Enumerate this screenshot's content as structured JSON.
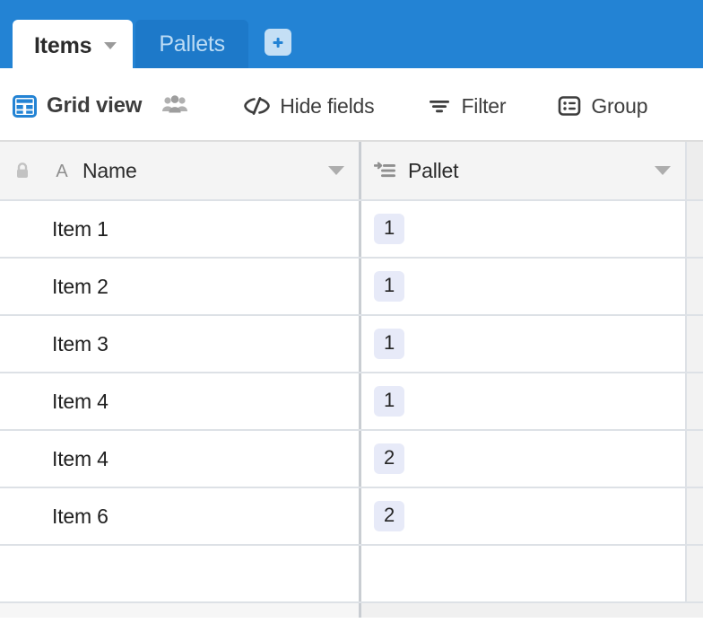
{
  "tabs": {
    "items": [
      {
        "label": "Items",
        "active": true,
        "caret_icon": "chevron-down-icon"
      },
      {
        "label": "Pallets",
        "active": false
      }
    ],
    "add_tab_icon": "plus-square-icon",
    "bar_color": "#2383d4",
    "active_tab_bg": "#ffffff",
    "inactive_tab_bg": "#1d79c9"
  },
  "toolbar": {
    "view_icon": "grid-view-icon",
    "view_label": "Grid view",
    "collaborators_icon": "people-icon",
    "hide_fields_icon": "hide-fields-icon",
    "hide_fields_label": "Hide fields",
    "filter_icon": "filter-icon",
    "filter_label": "Filter",
    "group_icon": "group-icon",
    "group_label": "Group"
  },
  "grid": {
    "columns": [
      {
        "label": "Name",
        "field_icon": "text-field-icon",
        "lock_icon": "lock-icon",
        "menu_icon": "chevron-down-icon"
      },
      {
        "label": "Pallet",
        "field_icon": "linked-record-icon",
        "menu_icon": "chevron-down-icon"
      }
    ],
    "rows": [
      {
        "name": "Item 1",
        "pallet": "1"
      },
      {
        "name": "Item 2",
        "pallet": "1"
      },
      {
        "name": "Item 3",
        "pallet": "1"
      },
      {
        "name": "Item 4",
        "pallet": "1"
      },
      {
        "name": "Item 4",
        "pallet": "2"
      },
      {
        "name": "Item 6",
        "pallet": "2"
      },
      {
        "name": "",
        "pallet": ""
      }
    ],
    "chip_color": "#e7eaf8"
  }
}
